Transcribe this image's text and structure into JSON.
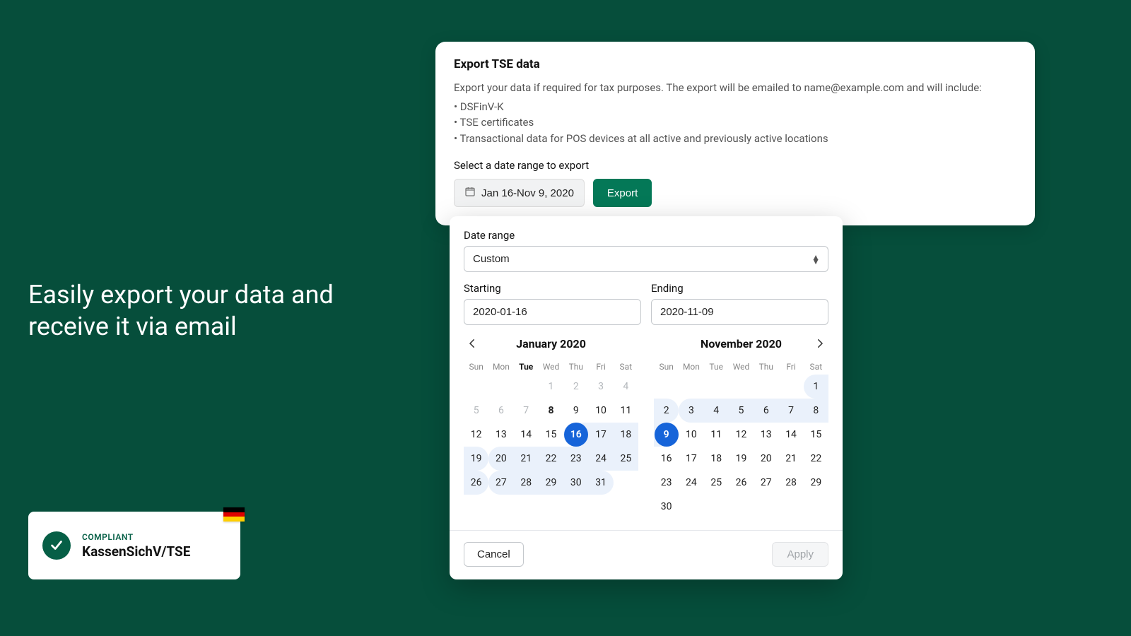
{
  "headline": "Easily export your data and receive it via email",
  "compliant": {
    "label": "COMPLIANT",
    "title": "KassenSichV/TSE"
  },
  "exportCard": {
    "title": "Export TSE data",
    "desc": "Export your data if required for tax purposes. The export will be emailed to name@example.com and will include:",
    "bullets": [
      "DSFinV-K",
      "TSE certificates",
      "Transactional data for POS devices at all active and previously active locations"
    ],
    "selectLabel": "Select a date range to export",
    "dateRangeDisplay": "Jan 16-Nov 9, 2020",
    "exportLabel": "Export"
  },
  "picker": {
    "dateRangeLabel": "Date range",
    "dateRangeValue": "Custom",
    "startingLabel": "Starting",
    "startingValue": "2020-01-16",
    "endingLabel": "Ending",
    "endingValue": "2020-11-09",
    "cancelLabel": "Cancel",
    "applyLabel": "Apply",
    "dow": [
      "Sun",
      "Mon",
      "Tue",
      "Wed",
      "Thu",
      "Fri",
      "Sat"
    ],
    "month1": {
      "title": "January 2020",
      "boldDowIndex": 2,
      "weeks": [
        [
          null,
          null,
          null,
          {
            "d": 1,
            "muted": true
          },
          {
            "d": 2,
            "muted": true
          },
          {
            "d": 3,
            "muted": true
          },
          {
            "d": 4,
            "muted": true
          }
        ],
        [
          {
            "d": 5,
            "muted": true
          },
          {
            "d": 6,
            "muted": true
          },
          {
            "d": 7,
            "muted": true
          },
          {
            "d": 8,
            "bold": true
          },
          {
            "d": 9
          },
          {
            "d": 10
          },
          {
            "d": 11
          }
        ],
        [
          {
            "d": 12
          },
          {
            "d": 13
          },
          {
            "d": 14
          },
          {
            "d": 15
          },
          {
            "d": 16,
            "selected": true,
            "range": true,
            "rl": true
          },
          {
            "d": 17,
            "range": true
          },
          {
            "d": 18,
            "range": true
          }
        ],
        [
          {
            "d": 19,
            "range": true,
            "rr": true
          },
          {
            "d": 20,
            "range": true,
            "rl": true
          },
          {
            "d": 21,
            "range": true
          },
          {
            "d": 22,
            "range": true
          },
          {
            "d": 23,
            "range": true
          },
          {
            "d": 24,
            "range": true
          },
          {
            "d": 25,
            "range": true
          }
        ],
        [
          {
            "d": 26,
            "range": true,
            "rr": true
          },
          {
            "d": 27,
            "range": true,
            "rl": true
          },
          {
            "d": 28,
            "range": true
          },
          {
            "d": 29,
            "range": true
          },
          {
            "d": 30,
            "range": true
          },
          {
            "d": 31,
            "range": true,
            "rr": true
          },
          null
        ]
      ]
    },
    "month2": {
      "title": "November 2020",
      "weeks": [
        [
          null,
          null,
          null,
          null,
          null,
          null,
          {
            "d": 1,
            "range": true,
            "rl": true
          }
        ],
        [
          {
            "d": 2,
            "range": true,
            "rr": true
          },
          {
            "d": 3,
            "range": true,
            "rl": true
          },
          {
            "d": 4,
            "range": true
          },
          {
            "d": 5,
            "range": true
          },
          {
            "d": 6,
            "range": true
          },
          {
            "d": 7,
            "range": true
          },
          {
            "d": 8,
            "range": true
          }
        ],
        [
          {
            "d": 9,
            "selected": true,
            "range": true,
            "rr": true
          },
          {
            "d": 10
          },
          {
            "d": 11
          },
          {
            "d": 12
          },
          {
            "d": 13
          },
          {
            "d": 14
          },
          {
            "d": 15
          }
        ],
        [
          {
            "d": 16
          },
          {
            "d": 17
          },
          {
            "d": 18
          },
          {
            "d": 19
          },
          {
            "d": 20
          },
          {
            "d": 21
          },
          {
            "d": 22
          }
        ],
        [
          {
            "d": 23
          },
          {
            "d": 24
          },
          {
            "d": 25
          },
          {
            "d": 26
          },
          {
            "d": 27
          },
          {
            "d": 28
          },
          {
            "d": 29
          }
        ],
        [
          {
            "d": 30
          },
          null,
          null,
          null,
          null,
          null,
          null
        ]
      ]
    }
  }
}
